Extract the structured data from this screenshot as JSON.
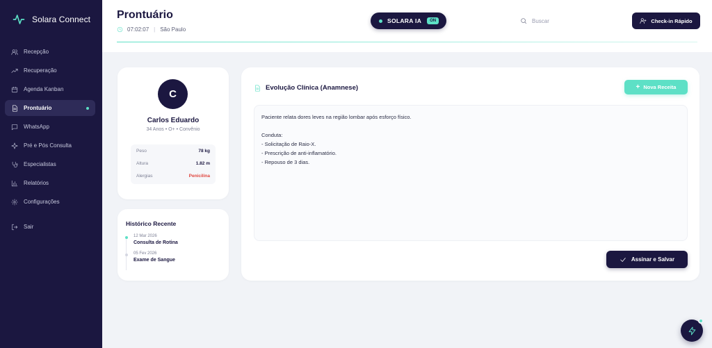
{
  "sidebar": {
    "brand": "Solara Connect",
    "items": [
      {
        "label": "Recepção",
        "icon": "users-icon"
      },
      {
        "label": "Recuperação",
        "icon": "trending-up-icon"
      },
      {
        "label": "Agenda Kanban",
        "icon": "calendar-icon"
      },
      {
        "label": "Prontuário",
        "icon": "document-icon",
        "active": true
      },
      {
        "label": "WhatsApp",
        "icon": "chat-icon"
      },
      {
        "label": "Pré e Pós Consulta",
        "icon": "sparkle-icon"
      },
      {
        "label": "Especialistas",
        "icon": "stethoscope-icon"
      },
      {
        "label": "Relatórios",
        "icon": "bar-chart-icon"
      },
      {
        "label": "Configurações",
        "icon": "gear-icon"
      }
    ],
    "logout": "Sair"
  },
  "header": {
    "title": "Prontuário",
    "time": "07:02:07",
    "location": "São Paulo",
    "ai_label": "SOLARA IA",
    "ai_status": "ON",
    "search_placeholder": "Buscar",
    "checkin_label": "Check-in Rápido"
  },
  "patient": {
    "initial": "C",
    "name": "Carlos Eduardo",
    "meta": "34 Anos • O+ • Convênio",
    "vitals": [
      {
        "key": "Peso",
        "value": "78 kg"
      },
      {
        "key": "Altura",
        "value": "1.82 m"
      },
      {
        "key": "Alergias",
        "value": "Penicilina"
      }
    ]
  },
  "history": {
    "title": "Histórico Recente",
    "items": [
      {
        "date": "12 Mar 2026",
        "label": "Consulta de Rotina"
      },
      {
        "date": "05 Fev 2026",
        "label": "Exame de Sangue"
      }
    ]
  },
  "evolution": {
    "title": "Evolução Clínica (Anamnese)",
    "new_rx_label": "Nova Receita",
    "text": "Paciente relata dores leves na região lombar após esforço físico.\n\nConduta:\n- Solicitação de Raio-X.\n- Prescrição de anti-inflamatório.\n- Repouso de 3 dias.",
    "sign_label": "Assinar e Salvar"
  },
  "colors": {
    "navy": "#1b1740",
    "mint": "#5de0c6",
    "alert": "#e0453d"
  }
}
